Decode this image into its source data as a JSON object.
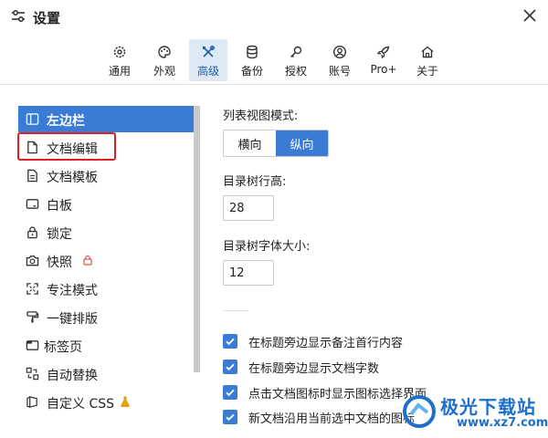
{
  "window": {
    "title": "设置"
  },
  "tabs": [
    {
      "label": "通用",
      "icon": "gear-icon"
    },
    {
      "label": "外观",
      "icon": "palette-icon"
    },
    {
      "label": "高级",
      "icon": "tools-icon",
      "active": true
    },
    {
      "label": "备份",
      "icon": "database-icon"
    },
    {
      "label": "授权",
      "icon": "key-icon"
    },
    {
      "label": "账号",
      "icon": "user-icon"
    },
    {
      "label": "Pro+",
      "icon": "rocket-icon"
    },
    {
      "label": "关于",
      "icon": "home-icon"
    }
  ],
  "sidebar": {
    "items": [
      {
        "label": "左边栏",
        "icon": "sidebar-icon",
        "active": true
      },
      {
        "label": "文档编辑",
        "icon": "document-icon"
      },
      {
        "label": "文档模板",
        "icon": "template-icon"
      },
      {
        "label": "白板",
        "icon": "whiteboard-icon"
      },
      {
        "label": "锁定",
        "icon": "lock-icon"
      },
      {
        "label": "快照",
        "icon": "camera-icon",
        "badge": "lock-badge-icon"
      },
      {
        "label": "专注模式",
        "icon": "focus-icon"
      },
      {
        "label": "一键排版",
        "icon": "format-painter-icon"
      },
      {
        "label": "标签页",
        "icon": "tab-page-icon"
      },
      {
        "label": "自动替换",
        "icon": "replace-icon"
      },
      {
        "label": "自定义 CSS",
        "icon": "css-icon",
        "badge": "flask-badge-icon"
      }
    ]
  },
  "main": {
    "list_view_mode": {
      "label": "列表视图模式:",
      "options": [
        "横向",
        "纵向"
      ],
      "selected": "纵向"
    },
    "tree_row_height": {
      "label": "目录树行高:",
      "value": "28"
    },
    "tree_font_size": {
      "label": "目录树字体大小:",
      "value": "12"
    },
    "checkboxes": [
      {
        "label": "在标题旁边显示备注首行内容",
        "checked": true
      },
      {
        "label": "在标题旁边显示文档字数",
        "checked": true
      },
      {
        "label": "点击文档图标时显示图标选择界面",
        "checked": true
      },
      {
        "label": "新文档沿用当前选中文档的图标",
        "checked": true
      }
    ]
  },
  "watermark": {
    "text": "极光下载站",
    "url": "www.xz7.com"
  },
  "colors": {
    "accent": "#3a7bd5",
    "active_tab_bg": "#dfe9f6",
    "highlight": "#e02020"
  }
}
